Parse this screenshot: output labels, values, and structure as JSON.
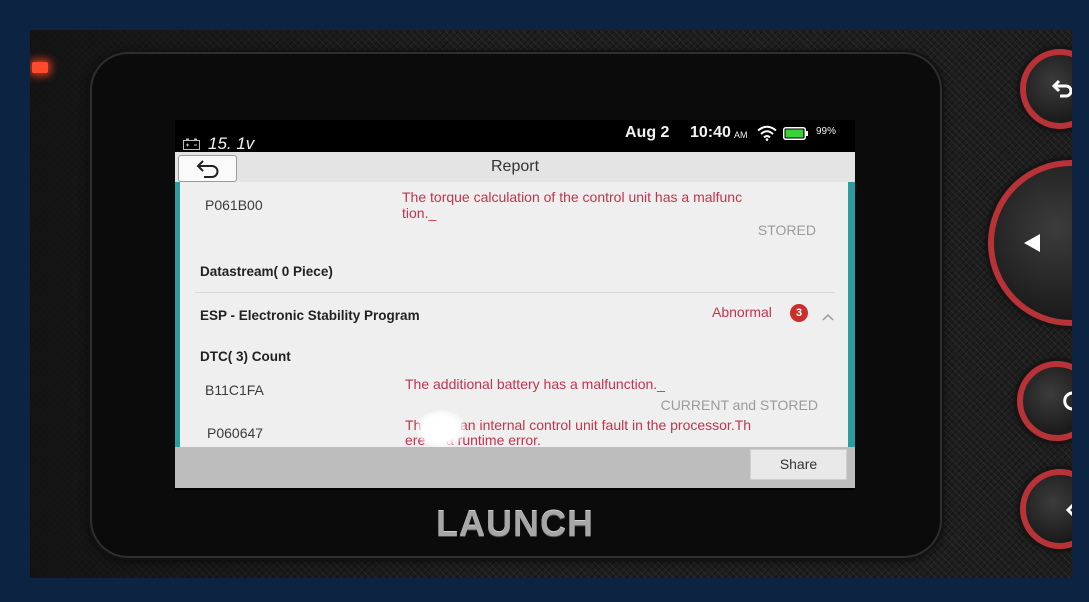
{
  "device": {
    "brand": "LAUNCH"
  },
  "status_bar": {
    "voltage": "15. 1v",
    "date": "Aug 2",
    "time": "10:40",
    "meridiem": "AM",
    "battery_percent": "99%",
    "battery_level": 0.99,
    "icons": {
      "voltage": "car-battery-icon",
      "wifi": "wifi-icon",
      "battery": "battery-icon"
    }
  },
  "title_bar": {
    "title": "Report",
    "back_icon": "back-arrow-icon"
  },
  "report": {
    "previous_entry": {
      "code": "P061B00",
      "description_lines": [
        "The torque calculation of the control unit has a malfunc",
        "tion._"
      ],
      "status": "STORED"
    },
    "datastream_heading": "Datastream( 0 Piece)",
    "system": {
      "name": "ESP - Electronic Stability Program",
      "status": "Abnormal",
      "fault_count": "3",
      "toggle_icon": "chevron-up-icon"
    },
    "dtc_heading": "DTC( 3) Count",
    "dtcs": [
      {
        "code": "B11C1FA",
        "description_lines": [
          "The additional battery has a malfunction._"
        ],
        "status": "CURRENT and STORED"
      },
      {
        "code": "P060647",
        "description_lines": [
          [
            "Th",
            "an internal control unit fault in the processor.Th"
          ],
          [
            "ere",
            "a runtime error."
          ]
        ]
      }
    ]
  },
  "bottom_bar": {
    "share_label": "Share"
  },
  "hardware_buttons": {
    "icons": [
      "back-arrow-icon",
      "triangle-left-icon",
      "circle-icon",
      "chevron-left-icon"
    ]
  },
  "colors": {
    "frame_border": "#0c2441",
    "accent_teal": "#2b9d9c",
    "fault_red": "#c0344f",
    "badge_red": "#c9302c",
    "button_ring_red": "#b83338",
    "battery_green": "#38d13a",
    "status_gray": "#9b9b9b"
  }
}
